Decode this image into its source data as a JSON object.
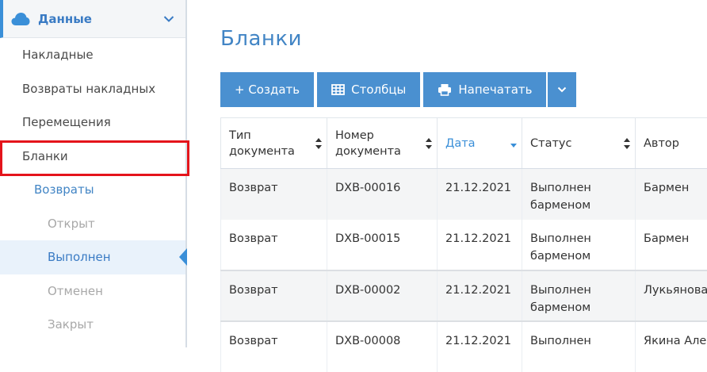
{
  "sidebar": {
    "header": {
      "title": "Данные"
    },
    "items": [
      {
        "label": "Накладные"
      },
      {
        "label": "Возвраты накладных"
      },
      {
        "label": "Перемещения"
      },
      {
        "label": "Бланки"
      },
      {
        "label": "Возвраты"
      },
      {
        "label": "Открыт"
      },
      {
        "label": "Выполнен"
      },
      {
        "label": "Отменен"
      },
      {
        "label": "Закрыт"
      }
    ]
  },
  "main": {
    "title": "Бланки",
    "toolbar": {
      "create_label": "+ Создать",
      "columns_label": "Столбцы",
      "print_label": "Напечатать"
    },
    "table": {
      "headers": [
        "Тип документа",
        "Номер документа",
        "Дата",
        "Статус",
        "Автор"
      ],
      "rows": [
        [
          "Возврат",
          "DXB-00016",
          "21.12.2021",
          "Выполнен барменом",
          "Бармен"
        ],
        [
          "Возврат",
          "DXB-00015",
          "21.12.2021",
          "Выполнен барменом",
          "Бармен"
        ],
        [
          "Возврат",
          "DXB-00002",
          "21.12.2021",
          "Выполнен барменом",
          "Лукьянова"
        ],
        [
          "Возврат",
          "DXB-00008",
          "21.12.2021",
          "Выполнен",
          "Якина Але"
        ]
      ]
    }
  },
  "icons": {
    "cloud": "cloud-icon",
    "chevron": "chevron-down-icon",
    "table": "table-icon",
    "print": "print-icon",
    "sort": "sort-icon"
  },
  "colors": {
    "accent": "#4a90d0",
    "highlight": "#e4141b"
  }
}
